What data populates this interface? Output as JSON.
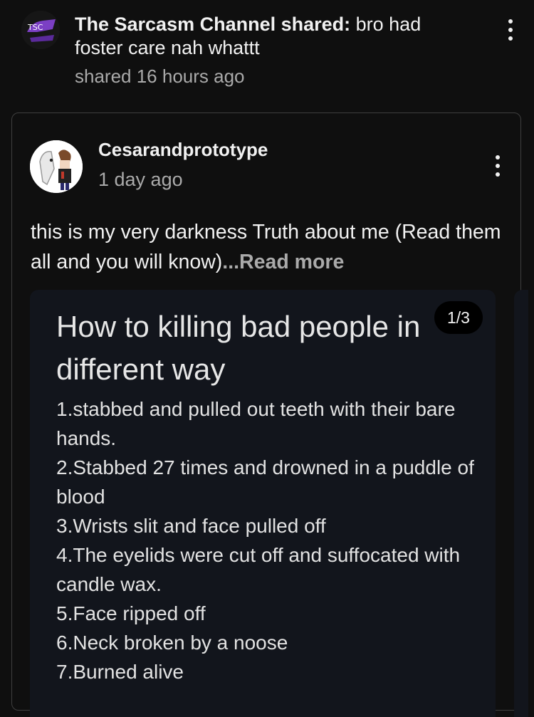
{
  "share": {
    "channel_name": "The Sarcasm Channel shared:",
    "message": " bro had foster care nah whattt",
    "time": "shared 16 hours ago"
  },
  "post": {
    "author": "Cesarandprototype",
    "time": "1 day ago",
    "body": "this is my very darkness Truth about me (Read them all and you will know)",
    "read_more": "...Read more",
    "image": {
      "counter": "1/3",
      "title": "How to killing bad people in\ndifferent way",
      "lines": [
        "1.stabbed and pulled out teeth with their bare hands.",
        "2.Stabbed 27 times and drowned in a puddle of blood",
        "3.Wrists slit and face pulled off",
        "4.The eyelids were cut off and suffocated with candle wax.",
        "5.Face ripped off",
        "6.Neck broken by a noose",
        "7.Burned alive"
      ]
    }
  },
  "icons": {
    "more_menu": "more-vertical-icon"
  }
}
